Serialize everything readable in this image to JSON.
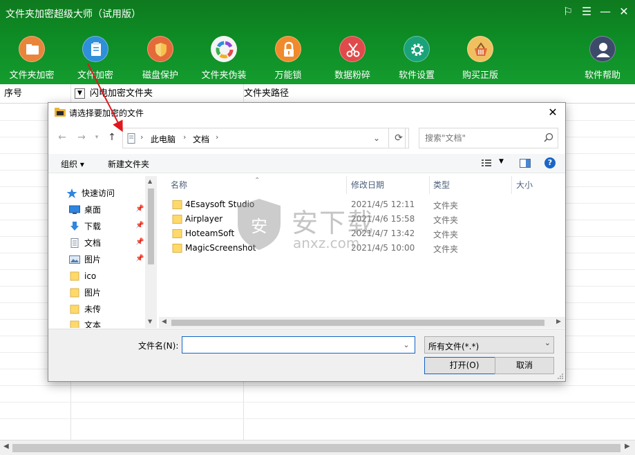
{
  "app": {
    "title": "文件夹加密超级大师（试用版）",
    "controls": {
      "skin": "⚐",
      "menu": "☰",
      "minimize": "—",
      "close": "✕"
    }
  },
  "toolbar": {
    "items": [
      {
        "label": "文件夹加密",
        "icon": "folder-icon",
        "color": "#e8853a"
      },
      {
        "label": "文件加密",
        "icon": "clipboard-icon",
        "color": "#2f8fd8"
      },
      {
        "label": "磁盘保护",
        "icon": "shield-icon",
        "color": "#e56a3a"
      },
      {
        "label": "文件夹伪装",
        "icon": "color-wheel-icon",
        "color": "#f4f4f4"
      },
      {
        "label": "万能锁",
        "icon": "lock-icon",
        "color": "#f08a2c"
      },
      {
        "label": "数据粉碎",
        "icon": "scissors-icon",
        "color": "#e04a4a"
      },
      {
        "label": "软件设置",
        "icon": "gear-icon",
        "color": "#1aa37a"
      },
      {
        "label": "购买正版",
        "icon": "basket-icon",
        "color": "#f0c060"
      },
      {
        "label": "软件帮助",
        "icon": "user-icon",
        "color": "#3e4a6a"
      }
    ]
  },
  "table": {
    "columns": [
      "序号",
      "闪电加密文件夹",
      "文件夹路径"
    ]
  },
  "dialog": {
    "title": "请选择要加密的文件",
    "close": "✕",
    "breadcrumb": [
      "此电脑",
      "文档"
    ],
    "search_placeholder": "搜索\"文档\"",
    "commands": {
      "organize": "组织 ▾",
      "new_folder": "新建文件夹"
    },
    "help": "?",
    "nav_items": [
      {
        "label": "快速访问",
        "icon": "star-icon",
        "pinned": false
      },
      {
        "label": "桌面",
        "icon": "desktop-icon",
        "pinned": true
      },
      {
        "label": "下载",
        "icon": "download-icon",
        "pinned": true
      },
      {
        "label": "文档",
        "icon": "document-icon",
        "pinned": true
      },
      {
        "label": "图片",
        "icon": "pictures-icon",
        "pinned": true
      },
      {
        "label": "ico",
        "icon": "folder-icon",
        "pinned": false
      },
      {
        "label": "图片",
        "icon": "folder-icon",
        "pinned": false
      },
      {
        "label": "未传",
        "icon": "folder-icon",
        "pinned": false
      },
      {
        "label": "文本",
        "icon": "folder-icon",
        "pinned": false
      }
    ],
    "file_columns": {
      "name": "名称",
      "date": "修改日期",
      "type": "类型",
      "size": "大小"
    },
    "files": [
      {
        "name": "4Esaysoft Studio",
        "date": "2021/4/5 12:11",
        "type": "文件夹"
      },
      {
        "name": "Airplayer",
        "date": "2021/4/6 15:58",
        "type": "文件夹"
      },
      {
        "name": "HoteamSoft",
        "date": "2021/4/7 13:42",
        "type": "文件夹"
      },
      {
        "name": "MagicScreenshot",
        "date": "2021/4/5 10:00",
        "type": "文件夹"
      }
    ],
    "filename_label": "文件名(N):",
    "filename_value": "",
    "filetype_value": "所有文件(*.*)",
    "open_label": "打开(O)",
    "cancel_label": "取消"
  },
  "watermark": {
    "text": "安下载",
    "sub": "anxz.com"
  }
}
